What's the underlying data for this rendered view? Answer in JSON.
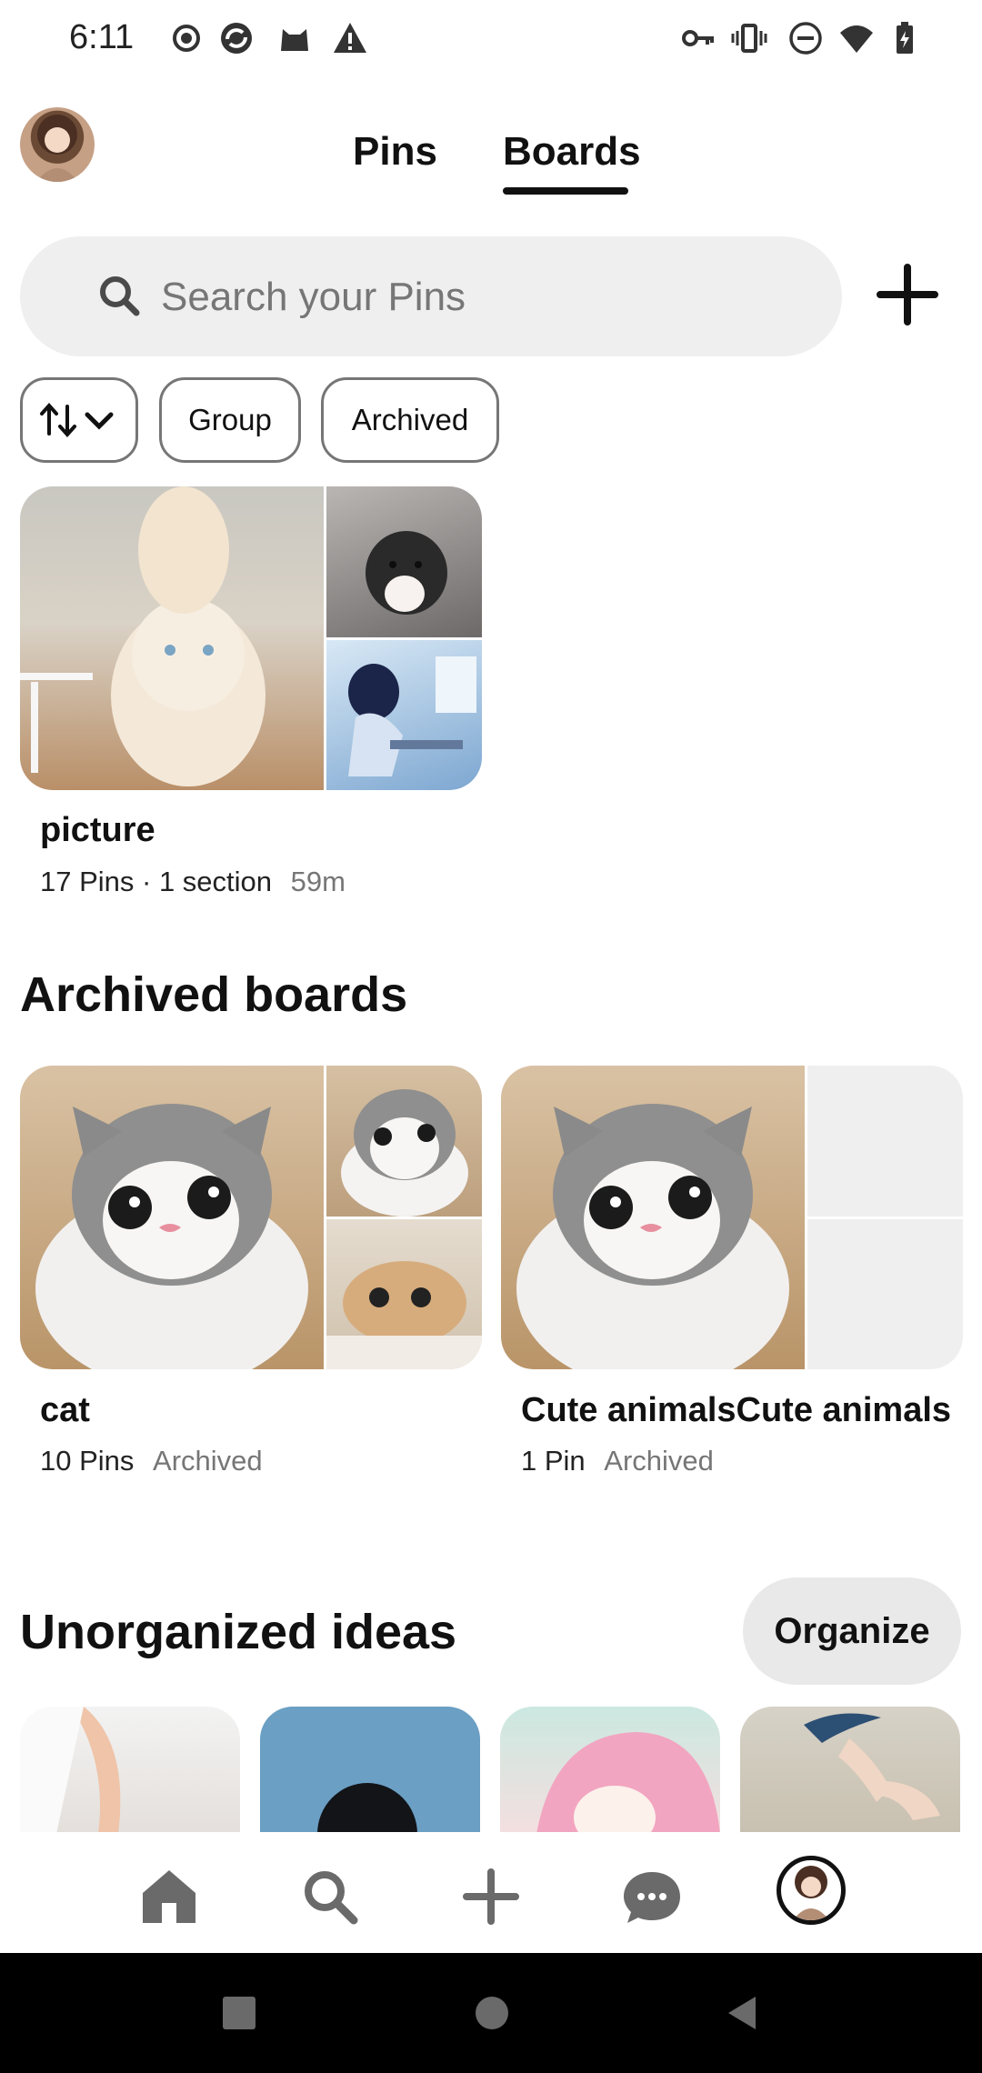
{
  "status": {
    "time": "6:11"
  },
  "tabs": [
    {
      "label": "Pins",
      "active": false
    },
    {
      "label": "Boards",
      "active": true
    }
  ],
  "search": {
    "placeholder": "Search your Pins"
  },
  "filters": {
    "group_label": "Group",
    "archived_label": "Archived"
  },
  "boards": [
    {
      "title": "picture",
      "meta": "17 Pins · 1 section",
      "time": "59m"
    }
  ],
  "archived_section": {
    "title": "Archived boards",
    "boards": [
      {
        "title": "cat",
        "pins": "10 Pins",
        "status": "Archived"
      },
      {
        "title": "Cute animalsCute animals",
        "pins": "1 Pin",
        "status": "Archived"
      }
    ]
  },
  "unorganized": {
    "title": "Unorganized ideas",
    "organize_label": "Organize"
  },
  "colors": {
    "accent": "#111111",
    "chip_border": "#767676",
    "search_bg": "#efefef"
  },
  "icons": [
    "search-icon",
    "plus-icon",
    "sort-icon",
    "home-icon",
    "messages-icon",
    "profile-icon"
  ]
}
